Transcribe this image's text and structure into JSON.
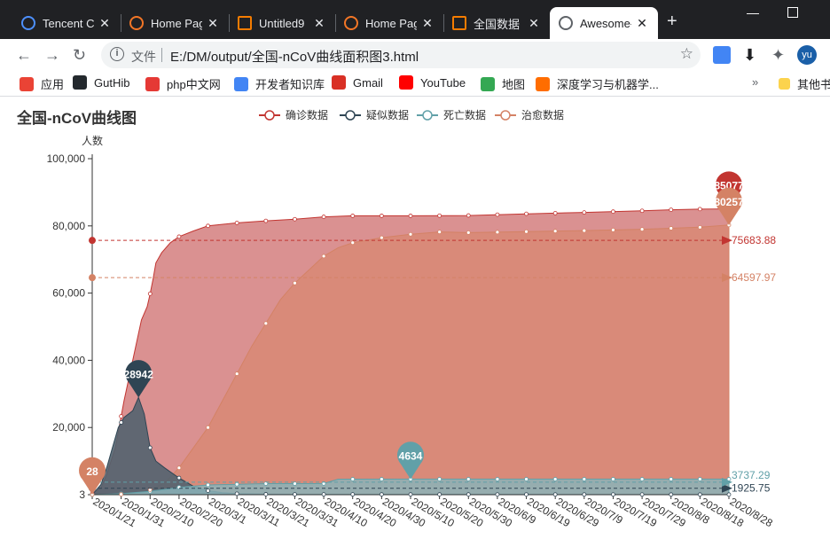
{
  "browser": {
    "tabs": [
      {
        "title": "Tencent C",
        "close": "✕",
        "icon": "cloud-icon",
        "color": "#4d90fe"
      },
      {
        "title": "Home Pag",
        "close": "✕",
        "icon": "jupyter-icon",
        "color": "#f37626"
      },
      {
        "title": "Untitled9",
        "close": "✕",
        "icon": "notebook-icon",
        "color": "#f57c00"
      },
      {
        "title": "Home Pag",
        "close": "✕",
        "icon": "jupyter-icon",
        "color": "#f37626"
      },
      {
        "title": "全国数据 -",
        "close": "✕",
        "icon": "notebook-icon",
        "color": "#f57c00"
      },
      {
        "title": "Awesome-",
        "close": "✕",
        "icon": "globe-icon",
        "color": "#5f6368"
      }
    ],
    "new_tab": "+",
    "address": {
      "file_label": "文件",
      "url": "E:/DM/output/全国-nCoV曲线面积图3.html"
    },
    "bookmarks": [
      {
        "label": "应用",
        "icon": "apps-icon",
        "color": "#ea4335"
      },
      {
        "label": "GutHib",
        "icon": "github-icon",
        "color": "#24292e"
      },
      {
        "label": "php中文网",
        "icon": "php-icon",
        "color": "#e53935"
      },
      {
        "label": "开发者知识库",
        "icon": "google-icon",
        "color": "#4285f4"
      },
      {
        "label": "Gmail",
        "icon": "gmail-icon",
        "color": "#d93025"
      },
      {
        "label": "YouTube",
        "icon": "youtube-icon",
        "color": "#ff0000"
      },
      {
        "label": "地图",
        "icon": "maps-icon",
        "color": "#34a853"
      },
      {
        "label": "深度学习与机器学...",
        "icon": "ad-icon",
        "color": "#ff6d00"
      }
    ],
    "bookmarks_more": "»",
    "other_bookmarks": "其他书",
    "profile": "yu"
  },
  "chart_data": {
    "type": "area",
    "title": "全国-nCoV曲线图",
    "ylabel": "人数",
    "ylim": [
      3,
      100000
    ],
    "y_ticks": [
      "3",
      "20,000",
      "40,000",
      "60,000",
      "80,000",
      "100,000"
    ],
    "x_labels": [
      "2020/1/21",
      "2020/1/31",
      "2020/2/10",
      "2020/2/20",
      "2020/3/1",
      "2020/3/11",
      "2020/3/21",
      "2020/3/31",
      "2020/4/10",
      "2020/4/20",
      "2020/4/30",
      "2020/5/10",
      "2020/5/20",
      "2020/5/30",
      "2020/6/9",
      "2020/6/19",
      "2020/6/29",
      "2020/7/9",
      "2020/7/19",
      "2020/7/29",
      "2020/8/8",
      "2020/8/18",
      "2020/8/28"
    ],
    "x_days": 220,
    "series": [
      {
        "name": "确诊数据",
        "color": "#c23531",
        "fill": "#d68585",
        "points": [
          [
            0,
            291
          ],
          [
            3,
            2000
          ],
          [
            5,
            6000
          ],
          [
            8,
            14000
          ],
          [
            11,
            28000
          ],
          [
            14,
            40000
          ],
          [
            17,
            52000
          ],
          [
            19,
            56000
          ],
          [
            20,
            59800
          ],
          [
            21,
            64000
          ],
          [
            22,
            69000
          ],
          [
            24,
            72000
          ],
          [
            27,
            75000
          ],
          [
            30,
            76800
          ],
          [
            35,
            78500
          ],
          [
            40,
            80000
          ],
          [
            50,
            80900
          ],
          [
            60,
            81500
          ],
          [
            70,
            82000
          ],
          [
            80,
            82700
          ],
          [
            90,
            83000
          ],
          [
            110,
            83000
          ],
          [
            130,
            83100
          ],
          [
            150,
            83600
          ],
          [
            170,
            84000
          ],
          [
            190,
            84500
          ],
          [
            200,
            84800
          ],
          [
            210,
            85000
          ],
          [
            220,
            85077
          ]
        ],
        "max_label": "85077",
        "avg": "75683.88"
      },
      {
        "name": "疑似数据",
        "color": "#2f4554",
        "fill": "#52636f",
        "points": [
          [
            0,
            54
          ],
          [
            3,
            3000
          ],
          [
            5,
            8000
          ],
          [
            7,
            14000
          ],
          [
            9,
            20000
          ],
          [
            11,
            23000
          ],
          [
            14,
            25000
          ],
          [
            16,
            28942
          ],
          [
            18,
            24000
          ],
          [
            20,
            14000
          ],
          [
            22,
            10000
          ],
          [
            25,
            8000
          ],
          [
            30,
            5000
          ],
          [
            35,
            2500
          ],
          [
            40,
            1200
          ],
          [
            45,
            600
          ],
          [
            50,
            300
          ],
          [
            60,
            150
          ],
          [
            70,
            100
          ],
          [
            220,
            50
          ]
        ],
        "max_label": "28942",
        "avg": "1925.75"
      },
      {
        "name": "死亡数据",
        "color": "#61a0a8",
        "fill": "#8ab3b8",
        "points": [
          [
            0,
            6
          ],
          [
            10,
            300
          ],
          [
            20,
            1000
          ],
          [
            30,
            2200
          ],
          [
            40,
            2900
          ],
          [
            50,
            3100
          ],
          [
            60,
            3300
          ],
          [
            70,
            3300
          ],
          [
            80,
            3340
          ],
          [
            85,
            4632
          ],
          [
            110,
            4634
          ],
          [
            220,
            4634
          ]
        ],
        "max_label": "4634",
        "avg": "3737.29"
      },
      {
        "name": "治愈数据",
        "color": "#d48265",
        "fill": "#d88a77",
        "points": [
          [
            0,
            28
          ],
          [
            10,
            100
          ],
          [
            15,
            300
          ],
          [
            20,
            1500
          ],
          [
            25,
            3500
          ],
          [
            30,
            8000
          ],
          [
            35,
            14000
          ],
          [
            40,
            20000
          ],
          [
            45,
            28000
          ],
          [
            50,
            36000
          ],
          [
            55,
            44000
          ],
          [
            60,
            51000
          ],
          [
            65,
            58000
          ],
          [
            70,
            63000
          ],
          [
            75,
            67000
          ],
          [
            80,
            71000
          ],
          [
            85,
            73500
          ],
          [
            90,
            75000
          ],
          [
            100,
            76500
          ],
          [
            110,
            77500
          ],
          [
            120,
            78200
          ],
          [
            130,
            78000
          ],
          [
            150,
            78300
          ],
          [
            170,
            78600
          ],
          [
            190,
            79000
          ],
          [
            210,
            79600
          ],
          [
            220,
            80257
          ]
        ],
        "max_label": "80257",
        "min_label": "28",
        "avg": "64597.97"
      }
    ],
    "legend_position": "top-center",
    "grid": false
  }
}
